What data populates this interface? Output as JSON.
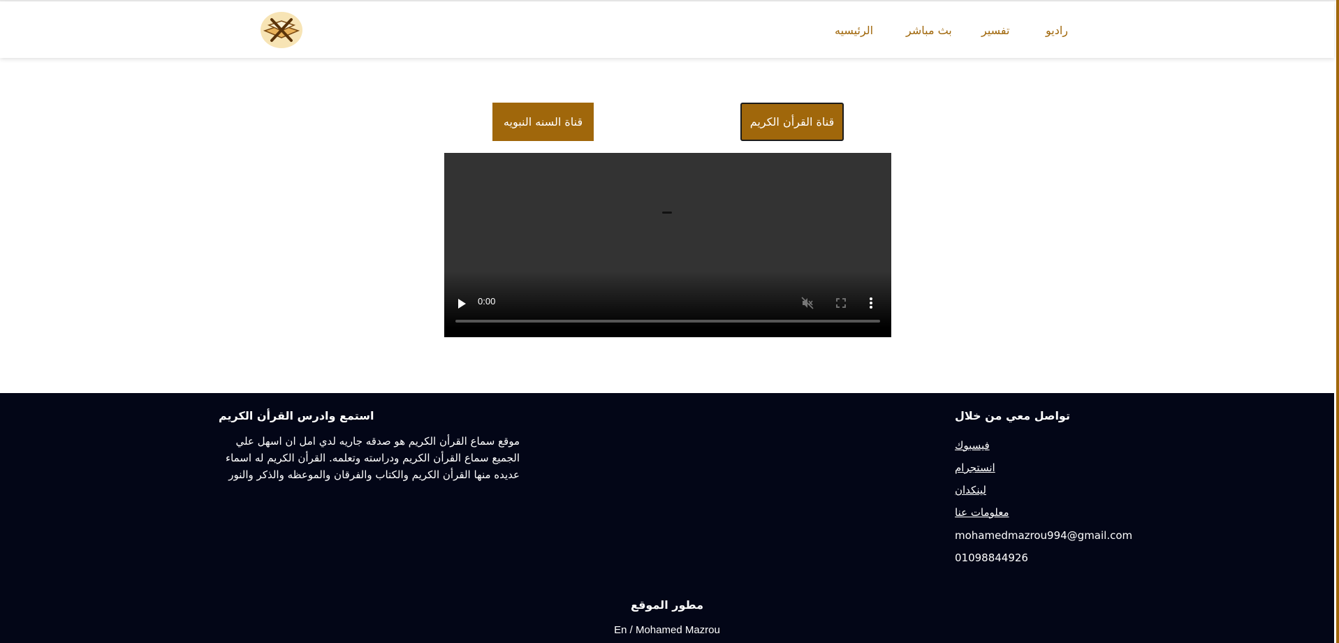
{
  "nav": {
    "items": [
      "راديو",
      "تفسير",
      "بث مباشر",
      "الرئيسيه"
    ]
  },
  "channels": {
    "quran": "قناة القرأن الكريم",
    "sunna": "قناة السنه النبويه"
  },
  "video": {
    "time": "0:00",
    "icons": [
      "play-icon",
      "mute-icon",
      "fullscreen-icon",
      "more-icon"
    ]
  },
  "footer": {
    "about_title": "استمع وادرس القرأن الكريم",
    "about_text": "موقع سماع القرأن الكريم هو صدقه جاريه لدي امل ان اسهل علي الجميع سماع القرأن الكريم ودراسته وتعلمه. القرأن الكريم له اسماء عديده منها القرأن الكريم والكتاب والفرقان والموعظه والذكر والنور",
    "contact_title": "تواصل معي من خلال",
    "links": [
      "فيسبوك",
      "انستجرام",
      "لينكدان",
      "معلومات عنا"
    ],
    "email": "mohamedmazrou994@gmail.com",
    "phone": "01098844926",
    "developer_title": "مطور الموقع",
    "developer_name": "En / Mohamed Mazrou"
  },
  "colors": {
    "accent": "#a0670b",
    "footer_bg": "#030617",
    "video_bg": "#333333"
  }
}
